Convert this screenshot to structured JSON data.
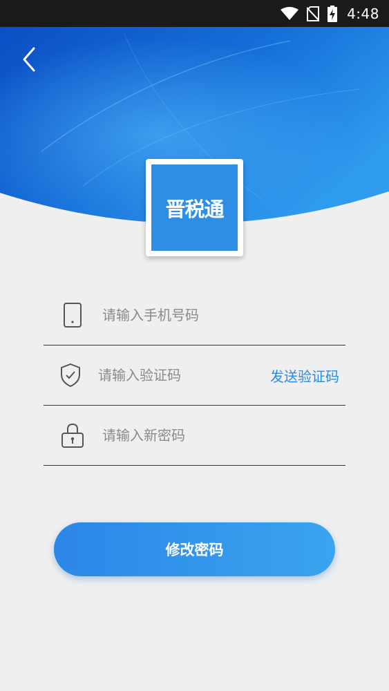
{
  "status_bar": {
    "time": "4:48",
    "icons": [
      "wifi-icon",
      "no-sim-icon",
      "battery-charging-icon"
    ]
  },
  "header": {
    "back_icon": "chevron-left-icon",
    "logo_text": "晋税通",
    "colors": {
      "hero_dark": "#0b4fc4",
      "hero_light": "#2f9bee",
      "logo_bg": "#2e8ee6"
    }
  },
  "form": {
    "phone": {
      "placeholder": "请输入手机号码",
      "value": "",
      "icon": "phone-icon"
    },
    "code": {
      "placeholder": "请输入验证码",
      "value": "",
      "icon": "shield-check-icon",
      "send_label": "发送验证码"
    },
    "password": {
      "placeholder": "请输入新密码",
      "value": "",
      "icon": "lock-icon"
    }
  },
  "submit": {
    "label": "修改密码"
  },
  "colors": {
    "accent": "#2a8be0",
    "background": "#efefef"
  }
}
